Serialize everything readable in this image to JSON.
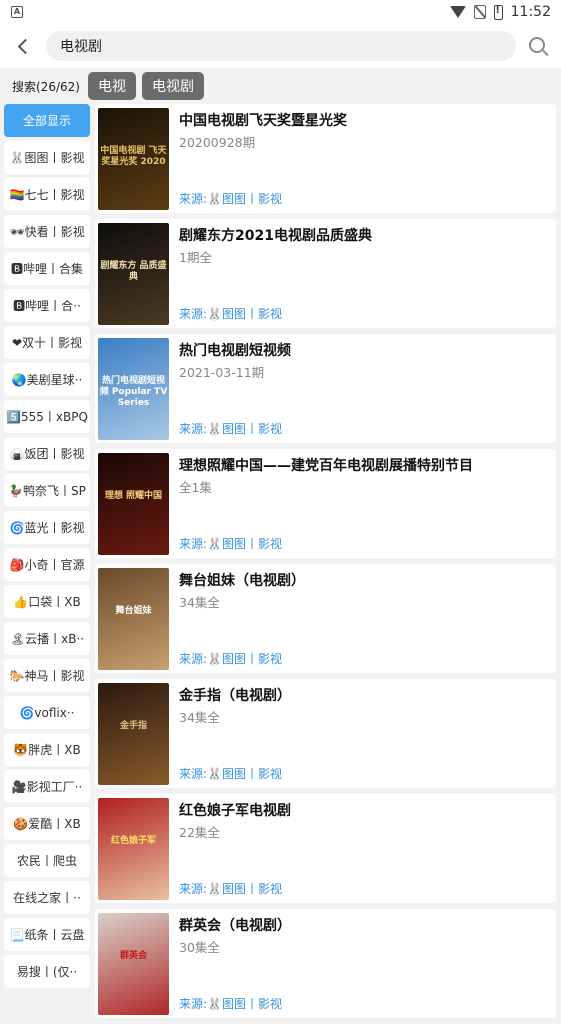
{
  "status_bar": {
    "time": "11:52",
    "left_icon": "A"
  },
  "header": {
    "search_value": "电视剧"
  },
  "filter": {
    "count_label": "搜索(26/62)",
    "chips": [
      "电视",
      "电视剧"
    ]
  },
  "sidebar": {
    "items": [
      "全部显示",
      "🐰图图丨影视",
      "🏳️‍🌈七七丨影视",
      "🕶快看丨影视",
      "🅱哔哩丨合集",
      "🅱哔哩丨合··",
      "❤双十丨影视",
      "🌏美剧星球··",
      "5️⃣555丨xBPQ",
      "🍙饭团丨影视",
      "🦆鸭奈飞丨SP",
      "🌀蓝光丨影视",
      "🎒小奇丨官源",
      "👍口袋丨XB",
      "🏝云播丨xB··",
      "🐎神马丨影视",
      "🌀voflix··",
      "🐯胖虎丨XB",
      "🎥影视工厂··",
      "🍪爱酷丨XB",
      "农民丨爬虫",
      "在线之家丨··",
      "📃纸条丨云盘",
      "易搜丨(仅··"
    ]
  },
  "results": [
    {
      "title": "中国电视剧飞天奖暨星光奖",
      "sub": "20200928期",
      "source": "来源:🐰图图丨影视",
      "poster_text": "中国电视剧 飞天奖星光奖 2020",
      "poster_colors": [
        "#1a1208",
        "#5c3d12"
      ],
      "poster_text_color": "#e8c46a"
    },
    {
      "title": "剧耀东方2021电视剧品质盛典",
      "sub": "1期全",
      "source": "来源:🐰图图丨影视",
      "poster_text": "剧耀东方 品质盛典",
      "poster_colors": [
        "#0e0d0b",
        "#4a3a22"
      ],
      "poster_text_color": "#f0e0b0"
    },
    {
      "title": "热门电视剧短视频",
      "sub": "2021-03-11期",
      "source": "来源:🐰图图丨影视",
      "poster_text": "热门电视剧短视频 Popular TV Series",
      "poster_colors": [
        "#3a7ec4",
        "#a9c8e4"
      ],
      "poster_text_color": "#ffffff"
    },
    {
      "title": "理想照耀中国——建党百年电视剧展播特别节目",
      "sub": "全1集",
      "source": "来源:🐰图图丨影视",
      "poster_text": "理想 照耀中国",
      "poster_colors": [
        "#1a0805",
        "#6a1a10"
      ],
      "poster_text_color": "#f2d27a"
    },
    {
      "title": "舞台姐妹（电视剧）",
      "sub": "34集全",
      "source": "来源:🐰图图丨影视",
      "poster_text": "舞台姐妹",
      "poster_colors": [
        "#6a4a2a",
        "#c8a070"
      ],
      "poster_text_color": "#ffffff"
    },
    {
      "title": "金手指（电视剧）",
      "sub": "34集全",
      "source": "来源:🐰图图丨影视",
      "poster_text": "金手指",
      "poster_colors": [
        "#2a1a10",
        "#8a5a2a"
      ],
      "poster_text_color": "#e0c080"
    },
    {
      "title": "红色娘子军电视剧",
      "sub": "22集全",
      "source": "来源:🐰图图丨影视",
      "poster_text": "红色娘子军",
      "poster_colors": [
        "#b02020",
        "#e8c0a0"
      ],
      "poster_text_color": "#ffe060"
    },
    {
      "title": "群英会（电视剧）",
      "sub": "30集全",
      "source": "来源:🐰图图丨影视",
      "poster_text": "群英会",
      "poster_colors": [
        "#d8d0c8",
        "#b02828"
      ],
      "poster_text_color": "#c01818"
    }
  ],
  "colors": {
    "accent": "#45a4f0",
    "source_link": "#3592e0",
    "chip_bg": "#6b6b6b"
  }
}
